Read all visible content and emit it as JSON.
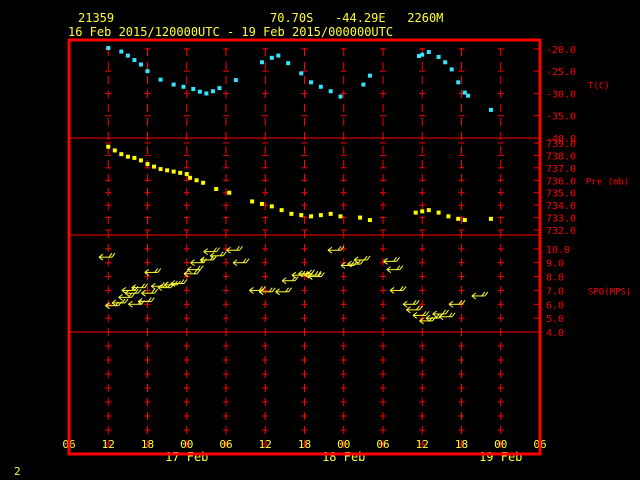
{
  "header": {
    "station_id": "21359",
    "location": "70.70S   -44.29E   2260M",
    "time_range": "16 Feb 2015/120000UTC - 19 Feb 2015/000000UTC"
  },
  "footer": {
    "page_number": "2"
  },
  "colors": {
    "frame": "#ff0000",
    "temperature": "#33e5ff",
    "pressure": "#ffff00",
    "wind": "#ffff33",
    "axis_text": "#ffff33",
    "panel_text": "#ff0000"
  },
  "chart_data": {
    "type": "scatter",
    "x_axis": {
      "unit": "hour",
      "range": [
        0,
        72
      ],
      "tick_labels": [
        "06",
        "12",
        "18",
        "00",
        "06",
        "12",
        "18",
        "00",
        "06",
        "12",
        "18",
        "00",
        "06"
      ],
      "date_labels": [
        {
          "label": "17 Feb",
          "at_tick": 3
        },
        {
          "label": "18 Feb",
          "at_tick": 7
        },
        {
          "label": "19 Feb",
          "at_tick": 11
        }
      ]
    },
    "panels": [
      {
        "name": "temperature",
        "label": "T(C)",
        "ylim": [
          -40,
          -18
        ],
        "ticks": [
          "-20.0",
          "-25.0",
          "-30.0",
          "-35.0",
          "-40.0"
        ],
        "tick_values": [
          -20,
          -25,
          -30,
          -35,
          -40
        ],
        "marker": "square",
        "points": [
          [
            6,
            -19.8
          ],
          [
            8,
            -20.6
          ],
          [
            9,
            -21.5
          ],
          [
            10,
            -22.5
          ],
          [
            11,
            -23.5
          ],
          [
            12,
            -25.0
          ],
          [
            14,
            -26.9
          ],
          [
            16,
            -28.0
          ],
          [
            17.5,
            -28.5
          ],
          [
            19,
            -29.0
          ],
          [
            20,
            -29.6
          ],
          [
            21,
            -30.0
          ],
          [
            22,
            -29.5
          ],
          [
            23,
            -28.8
          ],
          [
            25.5,
            -27.0
          ],
          [
            29.5,
            -23.0
          ],
          [
            31,
            -22.0
          ],
          [
            32,
            -21.5
          ],
          [
            33.5,
            -23.2
          ],
          [
            35.5,
            -25.5
          ],
          [
            37,
            -27.5
          ],
          [
            38.5,
            -28.5
          ],
          [
            40,
            -29.5
          ],
          [
            41.5,
            -30.7
          ],
          [
            45,
            -28.0
          ],
          [
            46,
            -26.0
          ],
          [
            53.5,
            -21.6
          ],
          [
            54,
            -21.3
          ],
          [
            55,
            -20.7
          ],
          [
            56.5,
            -21.8
          ],
          [
            57.5,
            -23.0
          ],
          [
            58.5,
            -24.6
          ],
          [
            59.5,
            -27.5
          ],
          [
            60.5,
            -29.8
          ],
          [
            61,
            -30.5
          ],
          [
            64.5,
            -33.7
          ]
        ]
      },
      {
        "name": "pressure",
        "label": "Pre (mb)",
        "ylim": [
          731.6,
          739.4
        ],
        "ticks": [
          "739.0",
          "738.0",
          "737.0",
          "736.0",
          "735.0",
          "734.0",
          "733.0",
          "732.0"
        ],
        "tick_values": [
          739,
          738,
          737,
          736,
          735,
          734,
          733,
          732
        ],
        "marker": "square",
        "points": [
          [
            6,
            738.7
          ],
          [
            7,
            738.4
          ],
          [
            8,
            738.1
          ],
          [
            9,
            737.9
          ],
          [
            10,
            737.8
          ],
          [
            11,
            737.6
          ],
          [
            12,
            737.3
          ],
          [
            13,
            737.1
          ],
          [
            14,
            736.9
          ],
          [
            15,
            736.8
          ],
          [
            16,
            736.7
          ],
          [
            17,
            736.6
          ],
          [
            18,
            736.5
          ],
          [
            18.5,
            736.2
          ],
          [
            19.5,
            736.0
          ],
          [
            20.5,
            735.8
          ],
          [
            22.5,
            735.3
          ],
          [
            24.5,
            735.0
          ],
          [
            28,
            734.3
          ],
          [
            29.5,
            734.1
          ],
          [
            31,
            733.9
          ],
          [
            32.5,
            733.6
          ],
          [
            34,
            733.3
          ],
          [
            35.5,
            733.2
          ],
          [
            37,
            733.1
          ],
          [
            38.5,
            733.2
          ],
          [
            40,
            733.3
          ],
          [
            41.5,
            733.1
          ],
          [
            44.5,
            733.0
          ],
          [
            46,
            732.8
          ],
          [
            53,
            733.4
          ],
          [
            54,
            733.5
          ],
          [
            55,
            733.6
          ],
          [
            56.5,
            733.4
          ],
          [
            58,
            733.1
          ],
          [
            59.5,
            732.9
          ],
          [
            60.5,
            732.8
          ],
          [
            64.5,
            732.9
          ]
        ]
      },
      {
        "name": "wind_speed",
        "label": "SPD(MPS)",
        "ylim": [
          4.0,
          11.0
        ],
        "ticks": [
          "10.0",
          "9.0",
          "8.0",
          "7.0",
          "6.0",
          "5.0",
          "4.0"
        ],
        "tick_values": [
          10,
          9,
          8,
          7,
          6,
          5,
          4
        ],
        "marker": "wind_barb",
        "points": [
          [
            5.5,
            9.4
          ],
          [
            6.5,
            5.9
          ],
          [
            7.5,
            6.1
          ],
          [
            8.5,
            6.5
          ],
          [
            9,
            7.0
          ],
          [
            9.5,
            6.8
          ],
          [
            10,
            6.0
          ],
          [
            10.5,
            7.2
          ],
          [
            11.5,
            6.2
          ],
          [
            12,
            6.8
          ],
          [
            12.5,
            8.3
          ],
          [
            13.5,
            7.3
          ],
          [
            14.5,
            7.2
          ],
          [
            15.5,
            7.4
          ],
          [
            16.5,
            7.5
          ],
          [
            18.5,
            8.2
          ],
          [
            19,
            8.5
          ],
          [
            19.5,
            9.0
          ],
          [
            21,
            9.2
          ],
          [
            21.5,
            9.8
          ],
          [
            22.5,
            9.5
          ],
          [
            25,
            9.9
          ],
          [
            26,
            9.0
          ],
          [
            28.5,
            7.0
          ],
          [
            30,
            6.9
          ],
          [
            32.5,
            6.9
          ],
          [
            33.5,
            7.7
          ],
          [
            35,
            8.1
          ],
          [
            36,
            8.2
          ],
          [
            37,
            8.1
          ],
          [
            37.5,
            8.0
          ],
          [
            40.5,
            9.9
          ],
          [
            42.5,
            8.8
          ],
          [
            43.5,
            8.9
          ],
          [
            44.5,
            9.2
          ],
          [
            49,
            9.1
          ],
          [
            49.5,
            8.5
          ],
          [
            50,
            7.0
          ],
          [
            52,
            6.0
          ],
          [
            52.5,
            5.6
          ],
          [
            53.5,
            5.2
          ],
          [
            54.5,
            4.8
          ],
          [
            55.5,
            5.0
          ],
          [
            56.5,
            5.3
          ],
          [
            57.5,
            5.1
          ],
          [
            59,
            6.0
          ],
          [
            62.5,
            6.6
          ]
        ]
      }
    ]
  }
}
